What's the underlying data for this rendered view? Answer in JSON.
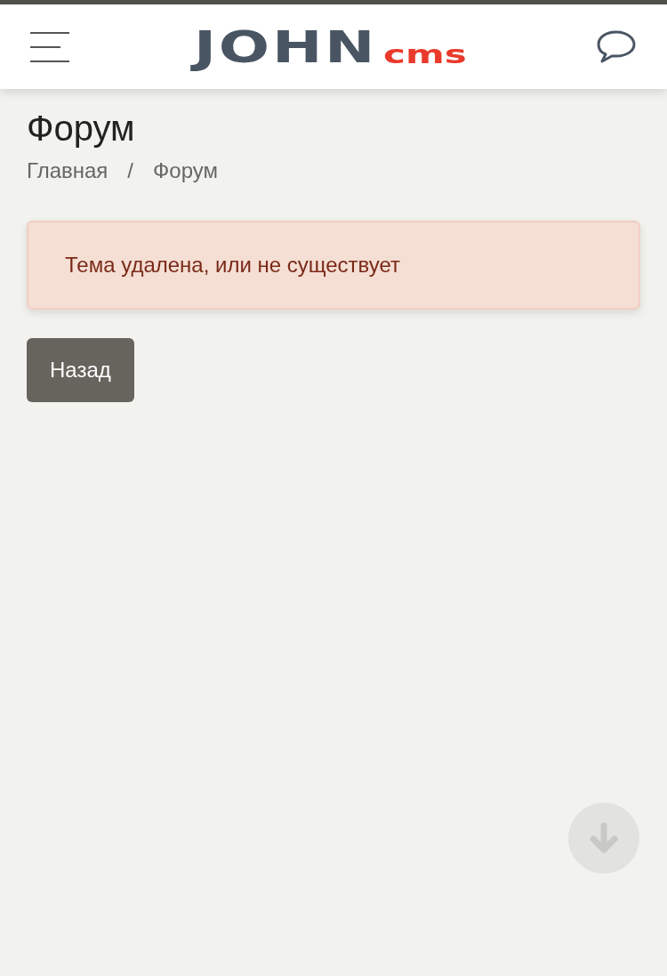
{
  "header": {
    "logo_main": "JOHN",
    "logo_sub": "cms"
  },
  "page": {
    "title": "Форум",
    "breadcrumbs": [
      {
        "label": "Главная"
      },
      {
        "separator": "/"
      },
      {
        "label": "Форум"
      }
    ]
  },
  "alert": {
    "text": "Тема удалена, или не существует"
  },
  "back_button": {
    "label": "Назад"
  }
}
